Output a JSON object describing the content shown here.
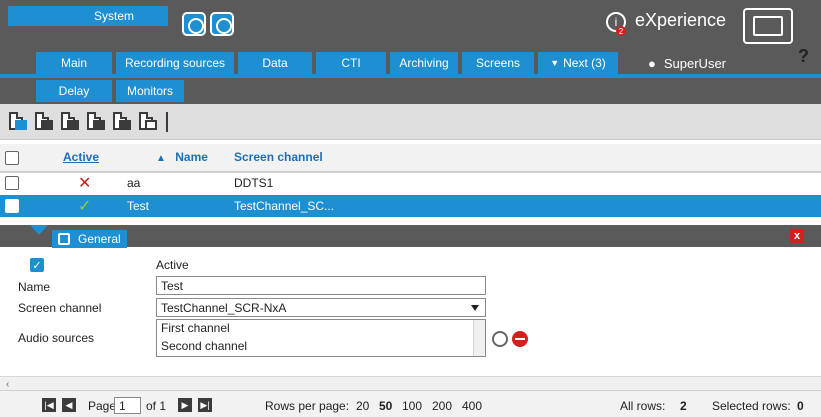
{
  "header": {
    "app_title": "System",
    "brand": "eXperience",
    "user": "SuperUser",
    "help_symbol": "?"
  },
  "nav": {
    "tabs": [
      "Main",
      "Recording sources",
      "Data",
      "CTI",
      "Archiving",
      "Screens",
      "Next (3)"
    ],
    "subtabs": [
      "Delay",
      "Monitors"
    ]
  },
  "grid": {
    "columns": [
      "Active",
      "Name",
      "Screen channel"
    ],
    "rows": [
      {
        "active": "✕",
        "name": "aa",
        "screen_channel": "DDTS1",
        "selected": false
      },
      {
        "active": "✓",
        "name": "Test",
        "screen_channel": "TestChannel_SC...",
        "selected": true
      }
    ]
  },
  "detail": {
    "tab_label": "General",
    "active_label": "Active",
    "name_label": "Name",
    "name_value": "Test",
    "screen_channel_label": "Screen channel",
    "screen_channel_value": "TestChannel_SCR-NxA",
    "audio_sources_label": "Audio sources",
    "audio_sources": [
      "First channel",
      "Second channel"
    ]
  },
  "footer": {
    "page_label": "Page",
    "page_value": "1",
    "of_label": "of 1",
    "rows_per_page_label": "Rows per page:",
    "rows_per_page_options": [
      "20",
      "50",
      "100",
      "200",
      "400"
    ],
    "selected_rows_per_page": "50",
    "all_rows_label": "All rows:",
    "all_rows_value": "2",
    "selected_rows_label": "Selected rows:",
    "selected_rows_value": "0"
  },
  "colors": {
    "accent": "#1e8fd1",
    "header_bg": "#5a5a5a",
    "error": "#cc1b1b",
    "success": "#8fcf3b"
  }
}
